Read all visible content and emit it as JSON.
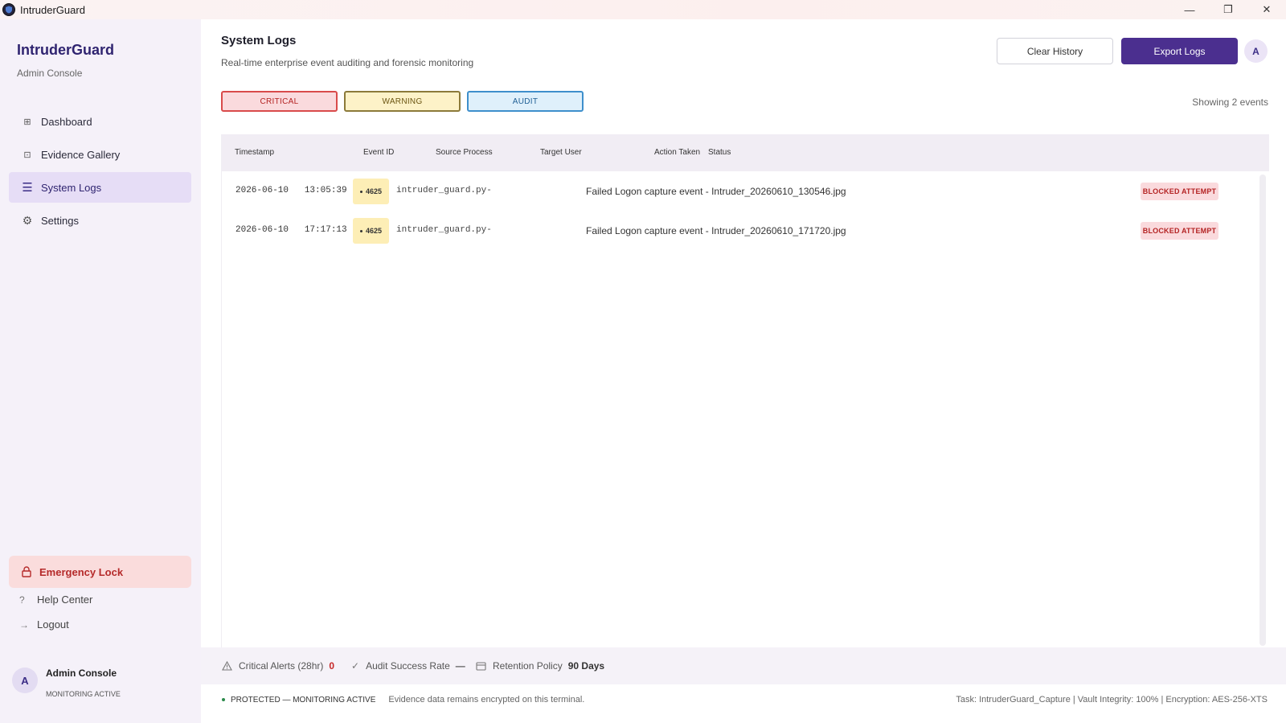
{
  "window": {
    "title": "IntruderGuard",
    "minimize": "—",
    "restore": "❐",
    "close": "✕"
  },
  "sidebar": {
    "brand": "IntruderGuard",
    "brand_sub": "Admin Console",
    "items": [
      {
        "label": "Dashboard",
        "icon": "grid-icon"
      },
      {
        "label": "Evidence Gallery",
        "icon": "gallery-icon"
      },
      {
        "label": "System Logs",
        "icon": "list-icon",
        "active": true
      },
      {
        "label": "Settings",
        "icon": "gear-icon"
      }
    ],
    "emergency_label": "Emergency Lock",
    "help_label": "Help Center",
    "logout_label": "Logout",
    "user": {
      "avatar": "A",
      "name": "Admin Console",
      "status": "MONITORING ACTIVE"
    }
  },
  "header": {
    "title": "System Logs",
    "subtitle": "Real-time enterprise event auditing and forensic monitoring",
    "clear_label": "Clear History",
    "export_label": "Export Logs",
    "avatar": "A"
  },
  "filters": {
    "critical": "CRITICAL",
    "warning": "WARNING",
    "audit": "AUDIT",
    "showing": "Showing 2 events"
  },
  "table": {
    "columns": {
      "timestamp": "Timestamp",
      "event_id": "Event ID",
      "source": "Source Process",
      "target": "Target User",
      "action": "Action Taken",
      "status": "Status"
    },
    "rows": [
      {
        "timestamp": "2026-06-10   13:05:39",
        "event_id": "4625",
        "source": "intruder_guard.py-",
        "action": "Failed Logon capture event - Intruder_20260610_130546.jpg",
        "status": "BLOCKED ATTEMPT"
      },
      {
        "timestamp": "2026-06-10   17:17:13",
        "event_id": "4625",
        "source": "intruder_guard.py-",
        "action": "Failed Logon capture event - Intruder_20260610_171720.jpg",
        "status": "BLOCKED ATTEMPT"
      }
    ]
  },
  "stats": {
    "critical_label": "Critical Alerts (28hr)",
    "critical_value": "0",
    "audit_label": "Audit Success Rate",
    "audit_value": "—",
    "retention_label": "Retention Policy",
    "retention_value": "90 Days"
  },
  "status_bar": {
    "protected": "PROTECTED — MONITORING ACTIVE",
    "message": "Evidence data remains encrypted on this terminal.",
    "right": "Task: IntruderGuard_Capture | Vault Integrity: 100%  |  Encryption: AES-256-XTS"
  },
  "colors": {
    "brand": "#2f2470",
    "accent": "#4b2f8f",
    "critical": "#b42323",
    "warning_bg": "#fdf2c8",
    "audit": "#1f5f95"
  }
}
